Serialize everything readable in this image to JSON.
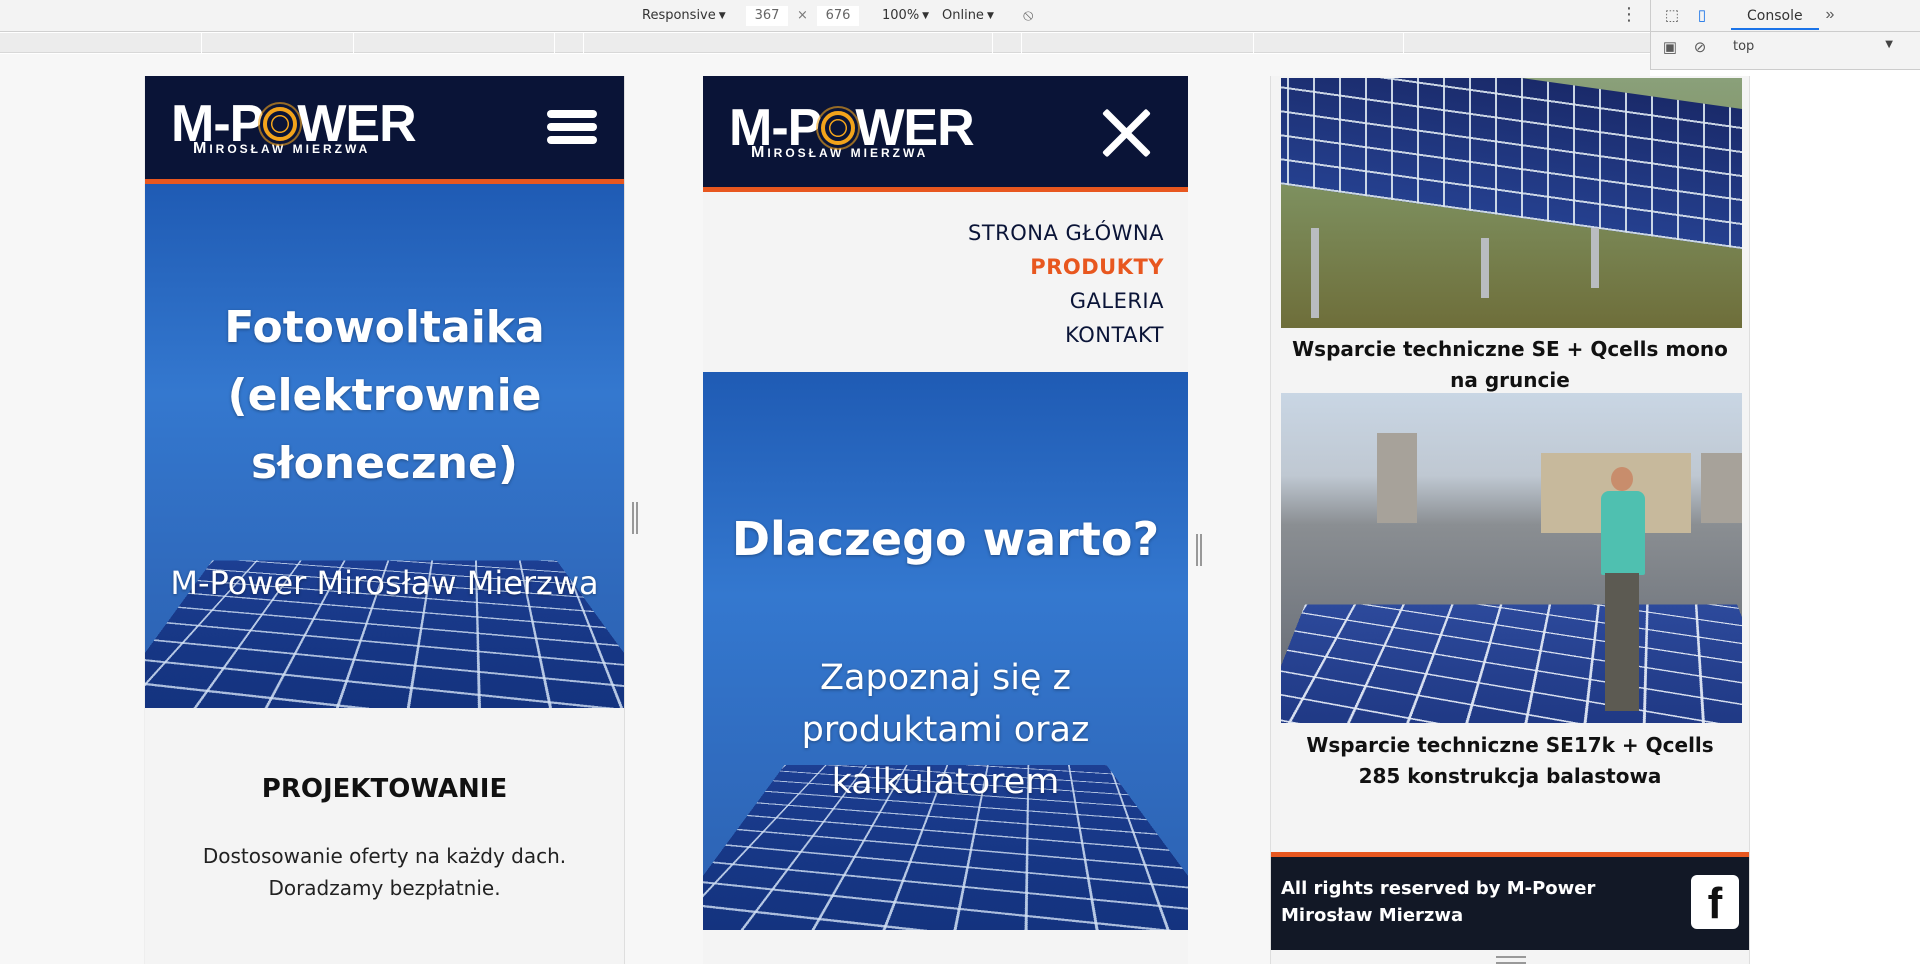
{
  "devtools": {
    "device": "Responsive",
    "width": "367",
    "times": "×",
    "height": "676",
    "zoom": "100%",
    "network": "Online",
    "console_tab": "Console",
    "more_tabs": "»",
    "context": "top",
    "menu_dots": "⋮"
  },
  "brand": {
    "logo_main_left": "M-P",
    "logo_main_right": "WER",
    "logo_sub": "IROSŁAW MIERZWA",
    "logo_sub_initial": "M",
    "accent_color": "#e8571f",
    "header_color": "#0a1437"
  },
  "frame1": {
    "hero_title": "Fotowoltaika (elektrownie słoneczne)",
    "hero_subtitle": "M-Power Mirosław Mierzwa",
    "section_title": "PROJEKTOWANIE",
    "section_line1": "Dostosowanie oferty na każdy dach.",
    "section_line2": "Doradzamy bezpłatnie."
  },
  "frame2": {
    "menu": [
      "STRONA GŁÓWNA",
      "PRODUKTY",
      "GALERIA",
      "KONTAKT"
    ],
    "active_menu": "PRODUKTY",
    "hero_title": "Dlaczego warto?",
    "hero_text": "Zapoznaj się z produktami oraz kalkulatorem"
  },
  "frame3": {
    "caption1": "Wsparcie techniczne SE + Qcells mono na gruncie",
    "caption2": "Wsparcie techniczne SE17k + Qcells 285 konstrukcja balastowa",
    "footer_text": "All rights reserved by M-Power Mirosław Mierzwa",
    "facebook_glyph": "f"
  }
}
